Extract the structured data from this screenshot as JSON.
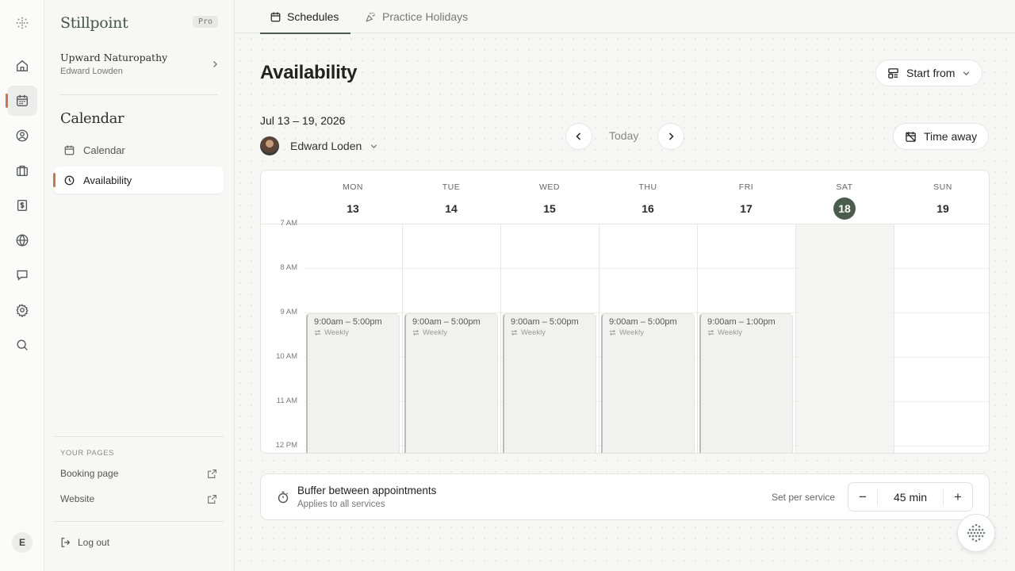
{
  "sidebar": {
    "brand": "Stillpoint",
    "plan_badge": "Pro",
    "practice_name": "Upward Naturopathy",
    "practice_owner": "Edward Lowden",
    "section_title": "Calendar",
    "nav": [
      {
        "label": "Calendar",
        "icon": "calendar-icon"
      },
      {
        "label": "Availability",
        "icon": "clock-icon",
        "active": true
      }
    ],
    "pages_label": "YOUR PAGES",
    "pages": [
      {
        "label": "Booking page",
        "icon": "external-link-icon"
      },
      {
        "label": "Website",
        "icon": "external-link-icon"
      }
    ],
    "logout_label": "Log out"
  },
  "rail": {
    "items": [
      "home-icon",
      "calendar-icon",
      "user-circle-icon",
      "briefcase-icon",
      "dollar-doc-icon",
      "globe-icon",
      "chat-icon",
      "gear-icon",
      "search-icon"
    ],
    "user_initial": "E"
  },
  "tabs": [
    {
      "label": "Schedules",
      "icon": "calendar-icon",
      "active": true
    },
    {
      "label": "Practice Holidays",
      "icon": "party-popper-icon"
    }
  ],
  "header": {
    "title": "Availability",
    "start_from_label": "Start from",
    "date_range": "Jul 13 – 19, 2026",
    "person_name": "Edward Loden",
    "today_label": "Today",
    "time_away_label": "Time away"
  },
  "calendar": {
    "days": [
      {
        "name": "MON",
        "num": "13"
      },
      {
        "name": "TUE",
        "num": "14"
      },
      {
        "name": "WED",
        "num": "15"
      },
      {
        "name": "THU",
        "num": "16"
      },
      {
        "name": "FRI",
        "num": "17"
      },
      {
        "name": "SAT",
        "num": "18",
        "today": true
      },
      {
        "name": "SUN",
        "num": "19"
      }
    ],
    "hours": [
      "7 AM",
      "8 AM",
      "9 AM",
      "10 AM",
      "11 AM",
      "12 PM"
    ],
    "blocks": [
      {
        "day": 0,
        "time": "9:00am – 5:00pm",
        "recurrence": "Weekly"
      },
      {
        "day": 1,
        "time": "9:00am – 5:00pm",
        "recurrence": "Weekly"
      },
      {
        "day": 2,
        "time": "9:00am – 5:00pm",
        "recurrence": "Weekly"
      },
      {
        "day": 3,
        "time": "9:00am – 5:00pm",
        "recurrence": "Weekly"
      },
      {
        "day": 4,
        "time": "9:00am – 1:00pm",
        "recurrence": "Weekly"
      }
    ]
  },
  "buffer": {
    "title": "Buffer between appointments",
    "subtitle": "Applies to all services",
    "per_service_label": "Set per service",
    "minus": "−",
    "value": "45 min",
    "plus": "+"
  },
  "colors": {
    "accent": "#4b5c4f",
    "active_marker": "#c9764f"
  }
}
